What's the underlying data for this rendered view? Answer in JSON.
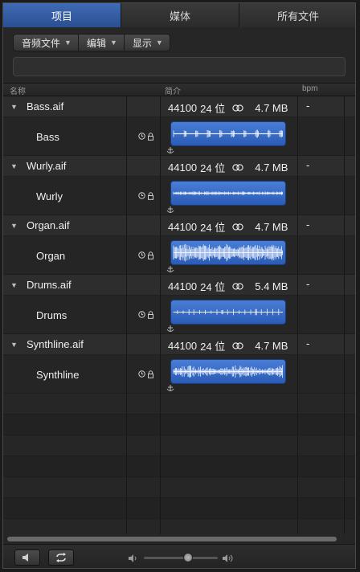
{
  "tabs": [
    {
      "label": "项目",
      "active": true
    },
    {
      "label": "媒体",
      "active": false
    },
    {
      "label": "所有文件",
      "active": false
    }
  ],
  "toolbar": {
    "audio_file": "音频文件",
    "edit": "编辑",
    "view": "显示"
  },
  "columns": {
    "name": "名称",
    "info": "简介",
    "bpm": "bpm"
  },
  "files": [
    {
      "name": "Bass.aif",
      "sample_rate": "44100",
      "bit_depth": "24 位",
      "size": "4.7 MB",
      "bpm": "-",
      "region": "Bass",
      "wave": "bass"
    },
    {
      "name": "Wurly.aif",
      "sample_rate": "44100",
      "bit_depth": "24 位",
      "size": "4.7 MB",
      "bpm": "-",
      "region": "Wurly",
      "wave": "wurly"
    },
    {
      "name": "Organ.aif",
      "sample_rate": "44100",
      "bit_depth": "24 位",
      "size": "4.7 MB",
      "bpm": "-",
      "region": "Organ",
      "wave": "organ"
    },
    {
      "name": "Drums.aif",
      "sample_rate": "44100",
      "bit_depth": "24 位",
      "size": "5.4 MB",
      "bpm": "-",
      "region": "Drums",
      "wave": "drums"
    },
    {
      "name": "Synthline.aif",
      "sample_rate": "44100",
      "bit_depth": "24 位",
      "size": "4.7 MB",
      "bpm": "-",
      "region": "Synthline",
      "wave": "synth"
    }
  ],
  "volume": 0.6,
  "colors": {
    "accent": "#3f6bb5",
    "region": "#3a6cc8"
  }
}
